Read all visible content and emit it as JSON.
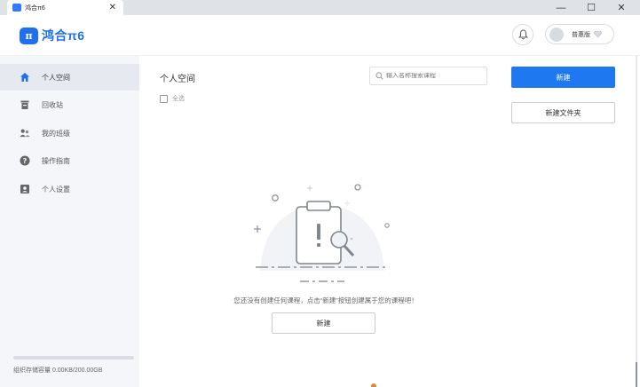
{
  "window": {
    "tab_title": "鸿合π6",
    "tab_close": "✕",
    "minimize": "—",
    "maximize": "☐",
    "close": "✕"
  },
  "header": {
    "logo_badge": "π",
    "logo_text": "鸿合π6",
    "edition": "普惠版"
  },
  "sidebar": {
    "items": [
      {
        "label": "个人空间",
        "icon": "home-icon"
      },
      {
        "label": "回收站",
        "icon": "trash-icon"
      },
      {
        "label": "我的班级",
        "icon": "class-group-icon"
      },
      {
        "label": "操作指南",
        "icon": "help-icon"
      },
      {
        "label": "个人设置",
        "icon": "profile-card-icon"
      }
    ],
    "storage_text": "组织存储容量 0.00KB/200.00GB",
    "storage_used_fraction": 0
  },
  "main": {
    "title": "个人空间",
    "select_all": "全选",
    "search_placeholder": "输入名称搜索课程",
    "new_button": "新建",
    "new_folder_button": "新建文件夹",
    "empty_message": "您还没有创建任何课程，点击“新建”按钮创建属于您的课程吧！",
    "empty_new_button": "新建"
  },
  "colors": {
    "accent": "#1e78f0",
    "sidebar_bg": "#f4f6f9",
    "sidebar_active_bg": "#e6e9ef"
  }
}
